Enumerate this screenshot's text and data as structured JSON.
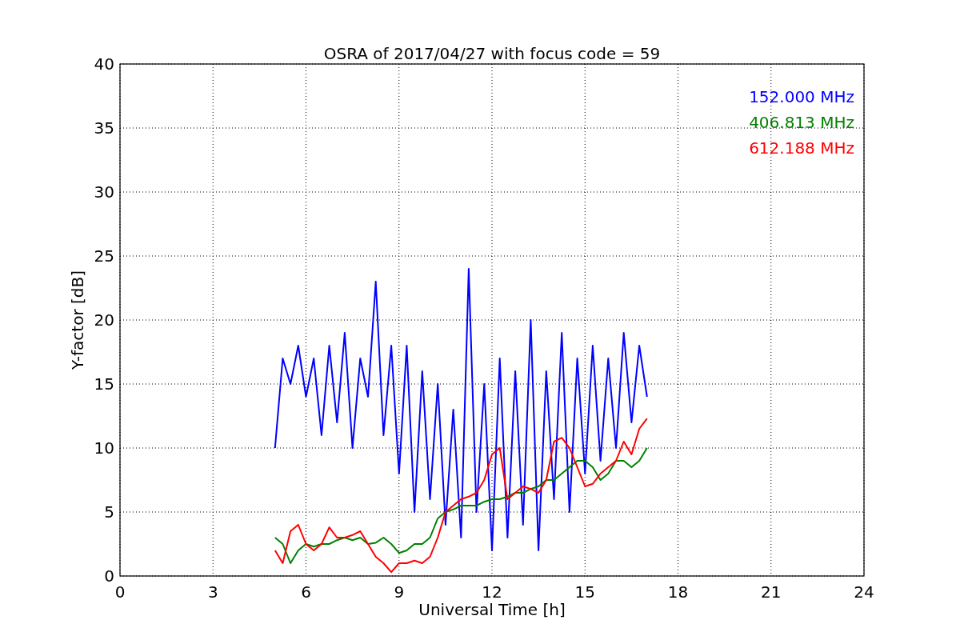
{
  "chart": {
    "chart_data": {
      "type": "line",
      "title": "OSRA of 2017/04/27 with focus code = 59",
      "xlabel": "Universal Time [h]",
      "ylabel": "Y-factor [dB]",
      "xlim": [
        0,
        24
      ],
      "ylim": [
        0,
        40
      ],
      "xticks": [
        0,
        3,
        6,
        9,
        12,
        15,
        18,
        21,
        24
      ],
      "yticks": [
        0,
        5,
        10,
        15,
        20,
        25,
        30,
        35,
        40
      ],
      "grid": true,
      "x": [
        5,
        5.25,
        5.5,
        5.75,
        6,
        6.25,
        6.5,
        6.75,
        7,
        7.25,
        7.5,
        7.75,
        8,
        8.25,
        8.5,
        8.75,
        9,
        9.25,
        9.5,
        9.75,
        10,
        10.25,
        10.5,
        10.75,
        11,
        11.25,
        11.5,
        11.75,
        12,
        12.25,
        12.5,
        12.75,
        13,
        13.25,
        13.5,
        13.75,
        14,
        14.25,
        14.5,
        14.75,
        15,
        15.25,
        15.5,
        15.75,
        16,
        16.25,
        16.5,
        16.75,
        17
      ],
      "series": [
        {
          "name": "152.000 MHz",
          "color": "#0000ff",
          "values": [
            10,
            17,
            15,
            18,
            14,
            17,
            11,
            18,
            12,
            19,
            10,
            17,
            14,
            23,
            11,
            18,
            8,
            18,
            5,
            16,
            6,
            15,
            4,
            13,
            3,
            24,
            5,
            15,
            2,
            17,
            3,
            16,
            4,
            20,
            2,
            16,
            6,
            19,
            5,
            17,
            8,
            18,
            9,
            17,
            10,
            19,
            12,
            18,
            14
          ]
        },
        {
          "name": "406.813 MHz",
          "color": "#008000",
          "values": [
            3,
            2.5,
            1,
            2,
            2.5,
            2.3,
            2.5,
            2.5,
            2.8,
            3,
            2.8,
            3,
            2.5,
            2.6,
            3,
            2.5,
            1.8,
            2,
            2.5,
            2.5,
            3,
            4.5,
            5,
            5.2,
            5.5,
            5.5,
            5.5,
            5.8,
            6,
            6,
            6.2,
            6.5,
            6.5,
            6.8,
            7,
            7.5,
            7.5,
            8,
            8.5,
            9,
            9,
            8.5,
            7.5,
            8,
            9,
            9,
            8.5,
            9,
            10
          ]
        },
        {
          "name": "612.188 MHz",
          "color": "#ff0000",
          "values": [
            2,
            1,
            3.5,
            4,
            2.5,
            2,
            2.5,
            3.8,
            3,
            3,
            3.2,
            3.5,
            2.5,
            1.5,
            1,
            0.3,
            1,
            1,
            1.2,
            1,
            1.5,
            3,
            5,
            5.5,
            6,
            6.2,
            6.5,
            7.5,
            9.5,
            10,
            6,
            6.5,
            7,
            6.8,
            6.5,
            7.5,
            10.5,
            10.8,
            10,
            8.5,
            7,
            7.2,
            8,
            8.5,
            9,
            10.5,
            9.5,
            11.5,
            12.3
          ]
        }
      ]
    }
  }
}
